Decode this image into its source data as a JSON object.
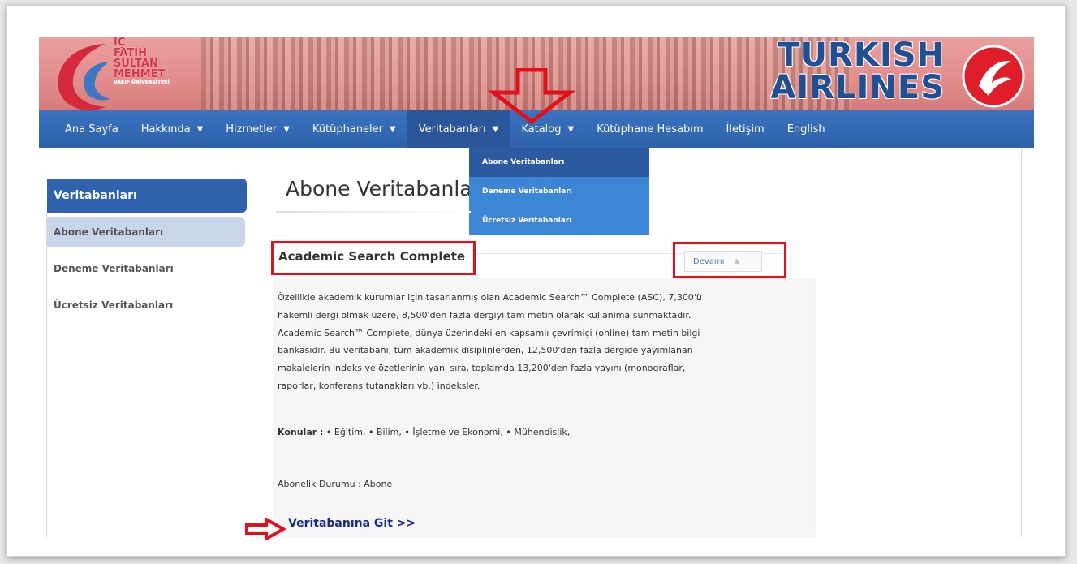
{
  "header": {
    "logo_lines": [
      "İÇ",
      "FATİH",
      "SULTAN",
      "MEHMET"
    ],
    "logo_sub": "VAKIF ÜNİVERSİTESİ",
    "airline_line1": "TURKISH",
    "airline_line2": "AIRLINES"
  },
  "nav": {
    "items": [
      {
        "label": "Ana Sayfa"
      },
      {
        "label": "Hakkında"
      },
      {
        "label": "Hizmetler"
      },
      {
        "label": "Kütüphaneler"
      },
      {
        "label": "Veritabanları"
      },
      {
        "label": "Katalog"
      },
      {
        "label": "Kütüphane Hesabım"
      },
      {
        "label": "İletişim"
      },
      {
        "label": "English"
      }
    ],
    "caret": "▼"
  },
  "dropdown": {
    "items": [
      "Abone Veritabanları",
      "Deneme Veritabanları",
      "Ücretsiz Veritabanları"
    ]
  },
  "sidebar": {
    "title": "Veritabanları",
    "items": [
      "Abone Veritabanları",
      "Deneme Veritabanları",
      "Ücretsiz Veritabanları"
    ]
  },
  "main": {
    "page_title": "Abone Veritabanları",
    "section_title": "Academic Search Complete",
    "devam_label": "Devamı",
    "devam_icon": "▲",
    "paragraph": [
      "Özellikle akademik kurumlar için tasarlanmış olan Academic Search™ Complete (ASC), 7,300'ü",
      "hakemli dergi olmak üzere, 8,500'den fazla dergiyi tam metin olarak kullanıma sunmaktadır.",
      "Academic Search™ Complete, dünya üzerindeki en kapsamlı çevrimiçi (online) tam metin bilgi",
      "bankasıdır. Bu veritabanı, tüm akademik disiplinlerden, 12,500'den fazla dergide yayımlanan",
      "makalelerin indeks ve özetlerinin yanı sıra, toplamda 13,200'den fazla yayını (monograflar,",
      "raporlar, konferans tutanakları vb.) indeksler."
    ],
    "topics_label": "Konular :",
    "topics_value": " • Eğitim, • Bilim, • İşletme ve Ekonomi, • Mühendislik,",
    "status": "Abonelik Durumu : Abone",
    "go_link": "Veritabanına Git >>"
  },
  "colors": {
    "nav_bg": "#2e62ab",
    "dropdown_bg": "#3d86d6",
    "annotation_red": "#e3101c",
    "link": "#1a2a8a"
  }
}
